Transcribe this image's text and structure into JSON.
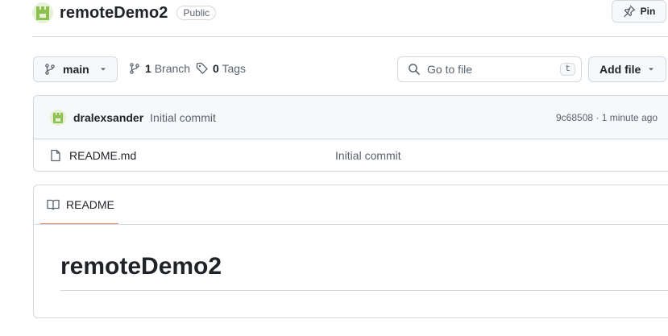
{
  "repo": {
    "name": "remoteDemo2",
    "visibility": "Public",
    "pin_label": "Pin"
  },
  "toolbar": {
    "branch_label": "main",
    "branch_count": "1",
    "branch_word": "Branch",
    "tag_count": "0",
    "tag_word": "Tags",
    "search_placeholder": "Go to file",
    "search_shortcut": "t",
    "add_file_label": "Add file"
  },
  "latest_commit": {
    "author": "dralexsander",
    "message": "Initial commit",
    "meta": "9c68508 · 1 minute ago"
  },
  "files": [
    {
      "name": "README.md",
      "commit_message": "Initial commit",
      "icon": "file-icon"
    }
  ],
  "readme": {
    "tab_label": "README",
    "heading": "remoteDemo2"
  },
  "colors": {
    "accent_underline": "#fd8c73",
    "border": "#d1d9e0",
    "muted_text": "#59636e",
    "avatar_green": "#8cc152"
  }
}
